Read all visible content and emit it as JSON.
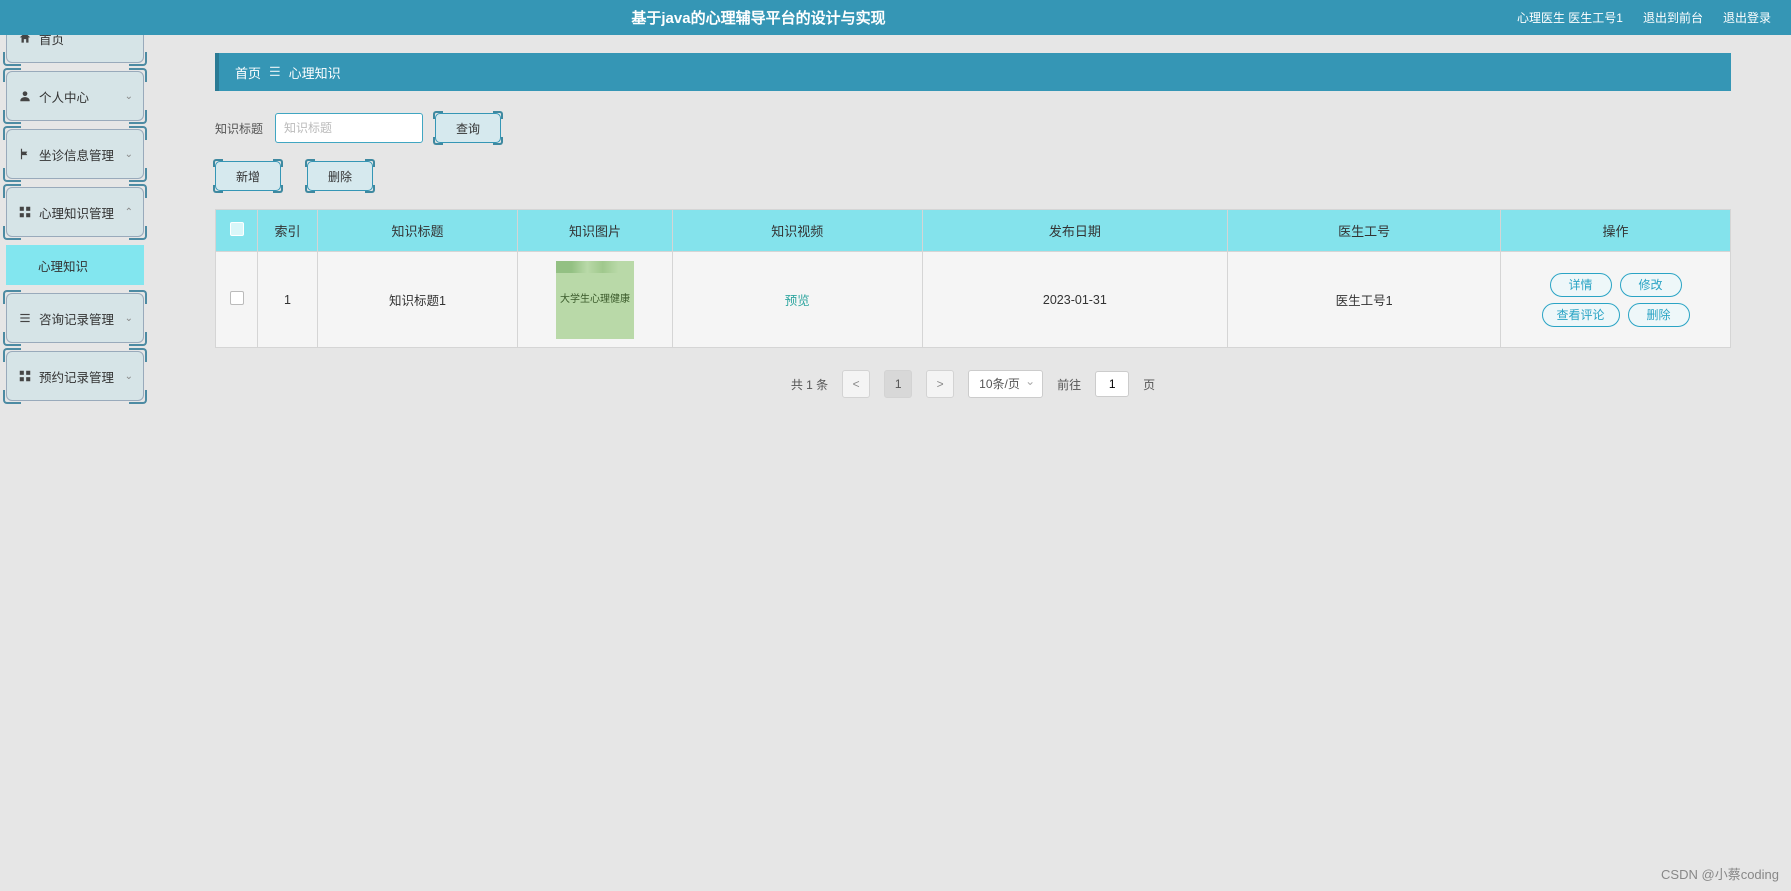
{
  "header": {
    "title": "基于java的心理辅导平台的设计与实现",
    "user_label": "心理医生 医生工号1",
    "logout_front": "退出到前台",
    "logout": "退出登录"
  },
  "sidebar": {
    "items": [
      {
        "icon": "home-icon",
        "label": "首页",
        "expandable": false
      },
      {
        "icon": "user-icon",
        "label": "个人中心",
        "expandable": true
      },
      {
        "icon": "flag-icon",
        "label": "坐诊信息管理",
        "expandable": true
      },
      {
        "icon": "grid-icon",
        "label": "心理知识管理",
        "expandable": true,
        "expanded": true,
        "children": [
          {
            "label": "心理知识"
          }
        ]
      },
      {
        "icon": "list-icon",
        "label": "咨询记录管理",
        "expandable": true
      },
      {
        "icon": "grid-icon",
        "label": "预约记录管理",
        "expandable": true
      }
    ]
  },
  "breadcrumb": {
    "home": "首页",
    "current": "心理知识"
  },
  "filters": {
    "title_label": "知识标题",
    "title_placeholder": "知识标题",
    "search_btn": "查询"
  },
  "toolbar": {
    "add_btn": "新增",
    "delete_btn": "删除"
  },
  "table": {
    "headers": [
      "索引",
      "知识标题",
      "知识图片",
      "知识视频",
      "发布日期",
      "医生工号",
      "操作"
    ],
    "rows": [
      {
        "index": "1",
        "title": "知识标题1",
        "image_caption": "大学生心理健康",
        "video_label": "预览",
        "date": "2023-01-31",
        "doctor_id": "医生工号1"
      }
    ],
    "ops": {
      "detail": "详情",
      "edit": "修改",
      "comments": "查看评论",
      "delete": "删除"
    }
  },
  "pagination": {
    "total_text": "共 1 条",
    "prev": "<",
    "current_page": "1",
    "next": ">",
    "per_page": "10条/页",
    "goto_prefix": "前往",
    "goto_value": "1",
    "goto_suffix": "页"
  },
  "watermark": "CSDN @小蔡coding"
}
